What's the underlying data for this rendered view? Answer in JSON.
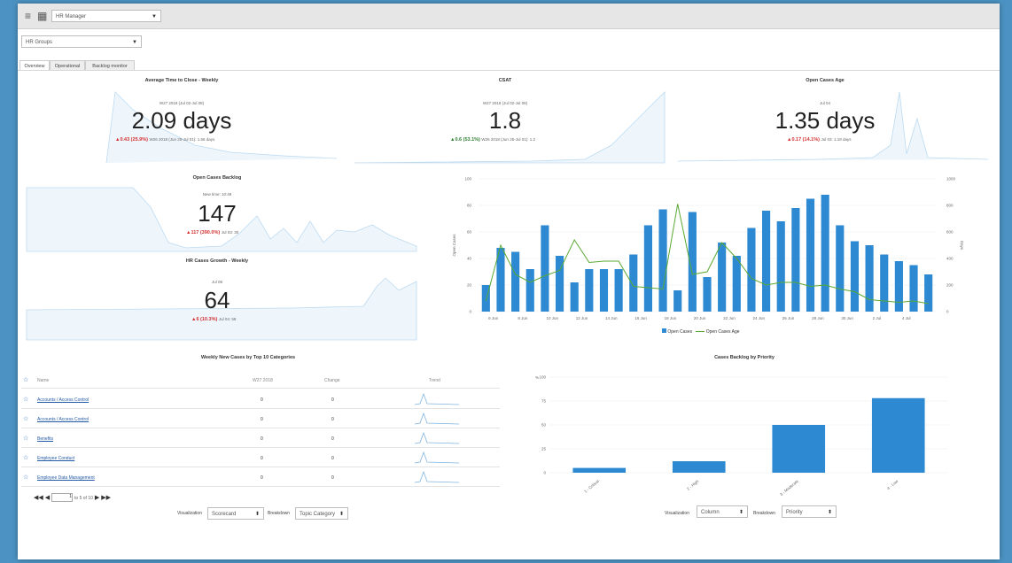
{
  "header": {
    "app_select": "HR Manager",
    "group_select": "HR Groups"
  },
  "tabs": [
    "Overview",
    "Operational",
    "Backlog monitor"
  ],
  "kpis": {
    "avg_close": {
      "title": "Average Time to Close - Weekly",
      "period": "W27 2018 (Jul 02-Jul 08)",
      "value": "2.09 days",
      "delta": "▲0.43 (25.9%)",
      "compare": "W26 2018 (Jun 25-Jul 01): 1.66 days"
    },
    "csat": {
      "title": "CSAT",
      "period": "W27 2018 (Jul 02-Jul 08)",
      "value": "1.8",
      "delta": "▲0.6 (53.1%)",
      "compare": "W26 2018 (Jun 25-Jul 01): 1.2"
    },
    "open_age": {
      "title": "Open Cases Age",
      "period": "Jul 04",
      "value": "1.35 days",
      "delta": "▲0.17 (14.1%)",
      "compare": "Jul 03: 1.18 days"
    },
    "backlog": {
      "title": "Open Cases Backlog",
      "period": "New time: 10:49",
      "value": "147",
      "delta": "▲117 (390.0%)",
      "compare": "Jul 03: 30"
    },
    "growth": {
      "title": "HR Cases Growth - Weekly",
      "period": "Jul 08",
      "value": "64",
      "delta": "▲6 (10.3%)",
      "compare": "Jul 04: 58"
    }
  },
  "chart_data": [
    {
      "type": "bar",
      "title": "",
      "ylabel": "Open Cases",
      "y2label": "Days",
      "ylim": [
        0,
        100
      ],
      "y2lim": [
        0,
        1000
      ],
      "yticks": [
        "0",
        "20",
        "40",
        "60",
        "80",
        "100"
      ],
      "y2ticks": [
        "0",
        "200",
        "400",
        "600",
        "800",
        "1000"
      ],
      "x_ticks": [
        "6 Jun",
        "8 Jun",
        "10 Jun",
        "12 Jun",
        "14 Jun",
        "16 Jun",
        "18 Jun",
        "20 Jun",
        "22 Jun",
        "24 Jun",
        "26 Jun",
        "28 Jun",
        "30 Jun",
        "2 Jul",
        "4 Jul"
      ],
      "series": [
        {
          "name": "Open Cases",
          "type": "bar",
          "color": "#2d8ad2",
          "values": [
            20,
            48,
            45,
            32,
            65,
            42,
            22,
            32,
            32,
            32,
            43,
            65,
            77,
            16,
            75,
            26,
            52,
            42,
            63,
            76,
            68,
            78,
            85,
            88,
            65,
            53,
            50,
            43,
            38,
            35,
            28
          ]
        },
        {
          "name": "Open Cases Age",
          "type": "line",
          "color": "#5aa832",
          "values": [
            80,
            500,
            280,
            220,
            270,
            310,
            540,
            370,
            380,
            380,
            190,
            180,
            170,
            810,
            280,
            300,
            520,
            400,
            250,
            200,
            220,
            220,
            190,
            200,
            170,
            150,
            90,
            80,
            70,
            80,
            60
          ]
        }
      ],
      "legend": "bottom"
    },
    {
      "type": "bar",
      "title": "Cases Backlog by Priority",
      "ylabel": "%",
      "ylim": [
        0,
        100
      ],
      "yticks": [
        "0",
        "25",
        "50",
        "75",
        "100"
      ],
      "categories": [
        "1 - Critical",
        "2 - High",
        "3 - Moderate",
        "4 - Low"
      ],
      "values": [
        5,
        12,
        50,
        78
      ],
      "color": "#2d8ad2"
    }
  ],
  "table": {
    "title": "Weekly New Cases by Top 10 Categories",
    "columns": [
      "Name",
      "W27 2018",
      "Change",
      "Trend"
    ],
    "rows": [
      {
        "name": "Accounts / Access Control",
        "value": "0",
        "change": "0"
      },
      {
        "name": "Accounts / Access Control",
        "value": "0",
        "change": "0"
      },
      {
        "name": "Benefits",
        "value": "0",
        "change": "0"
      },
      {
        "name": "Employee Conduct",
        "value": "0",
        "change": "0"
      },
      {
        "name": "Employee Data Management",
        "value": "0",
        "change": "0"
      }
    ],
    "pager_text": "to 5 of 10",
    "pager_value": "1"
  },
  "controls_left": {
    "vis_label": "Visualization",
    "vis_value": "Scorecard",
    "bd_label": "Breakdown",
    "bd_value": "Topic Category"
  },
  "controls_right": {
    "vis_label": "Visualization",
    "vis_value": "Column",
    "bd_label": "Breakdown",
    "bd_value": "Priority"
  }
}
